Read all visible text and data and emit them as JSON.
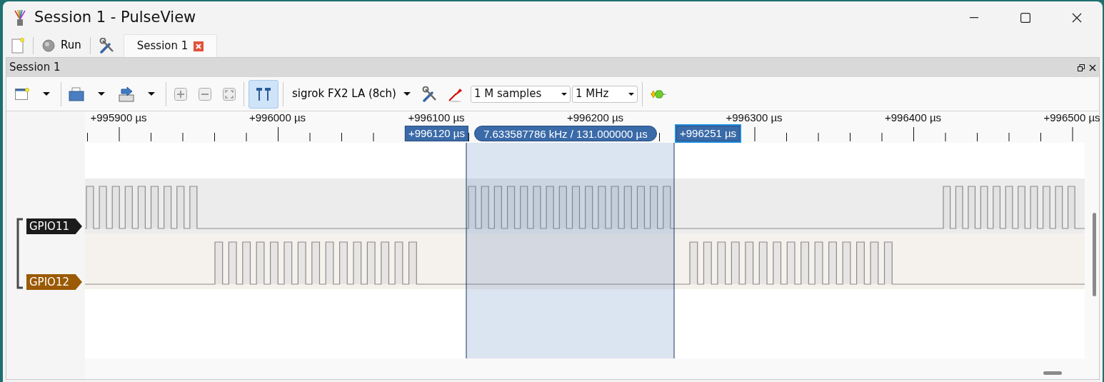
{
  "window": {
    "title": "Session 1 - PulseView"
  },
  "main_toolbar": {
    "run_button": "Run"
  },
  "tabs": [
    {
      "label": "Session 1",
      "selected": true
    }
  ],
  "dock": {
    "title": "Session 1"
  },
  "toolbar": {
    "device": "sigrok FX2 LA (8ch)",
    "sample_count": "1 M samples",
    "sample_rate": "1 MHz",
    "cursors_enabled": true
  },
  "ruler": {
    "ticks": [
      "+995900 µs",
      "+996000 µs",
      "+996100 µs",
      "+996200 µs",
      "+996300 µs",
      "+996400 µs",
      "+996500 µs"
    ],
    "cursors": {
      "start": "+996120 µs",
      "end": "+996251 µs",
      "measurement": "7.633587786 kHz / 131.000000 µs"
    }
  },
  "channels": [
    {
      "name": "GPIO11",
      "color": "#1b1b1b"
    },
    {
      "name": "GPIO12",
      "color": "#9b5a05"
    }
  ]
}
